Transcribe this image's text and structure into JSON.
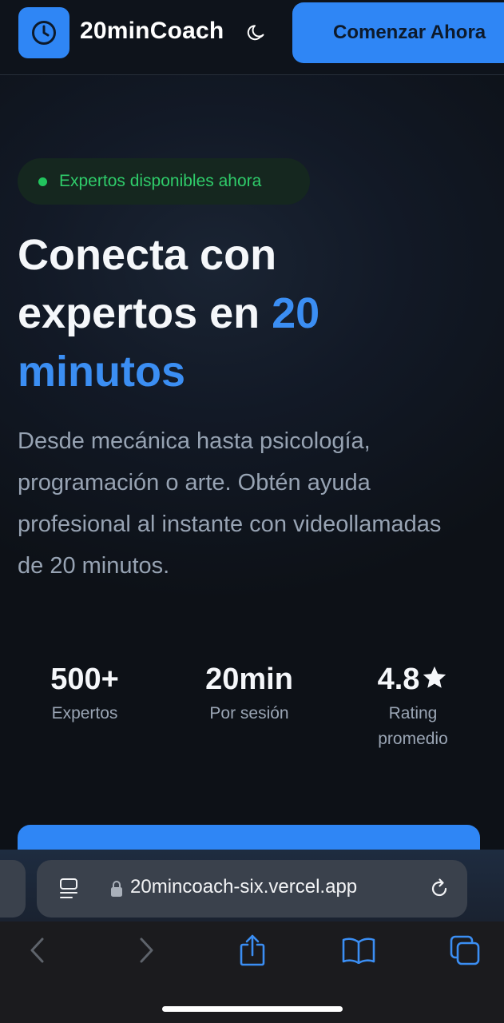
{
  "header": {
    "brand": "20minCoach",
    "cta_label": "Comenzar Ahora"
  },
  "hero": {
    "badge": "Expertos disponibles ahora",
    "title_line1": "Conecta con",
    "title_line2_start": "expertos en ",
    "title_accent_1": "20",
    "title_accent_2": "minutos",
    "description": "Desde mecánica hasta psicología, programación o arte. Obtén ayuda profesional al instante con videollamadas de 20 minutos."
  },
  "stats": [
    {
      "value": "500+",
      "label": "Expertos"
    },
    {
      "value": "20min",
      "label": "Por sesión"
    },
    {
      "value": "4.8",
      "label": "Rating promedio"
    }
  ],
  "browser": {
    "url": "20mincoach-six.vercel.app"
  },
  "colors": {
    "accent": "#2f86f5",
    "badge_green": "#22c55e",
    "background": "#0d1117"
  },
  "icons": {
    "logo": "clock-icon",
    "theme": "moon-icon",
    "rating": "star-icon",
    "reader": "reader-icon",
    "secure": "lock-icon",
    "reload": "reload-icon",
    "back": "chevron-left-icon",
    "forward": "chevron-right-icon",
    "share": "share-icon",
    "bookmarks": "book-icon",
    "tabs": "tabs-icon"
  }
}
